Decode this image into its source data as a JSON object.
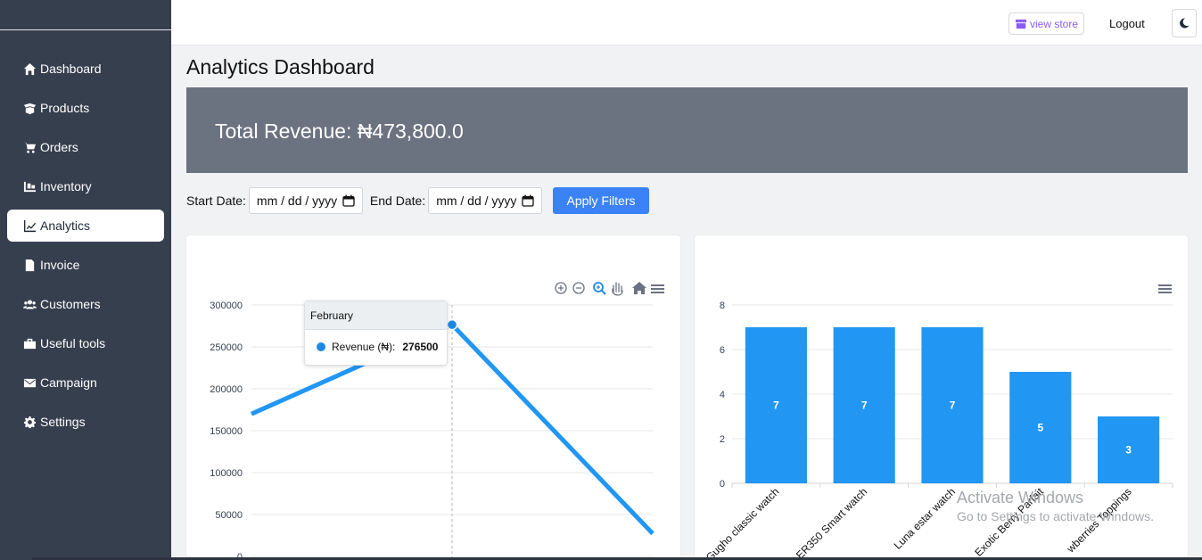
{
  "sidebar": {
    "items": [
      {
        "label": "Dashboard",
        "icon": "home-icon",
        "active": false
      },
      {
        "label": "Products",
        "icon": "box-open-icon",
        "active": false
      },
      {
        "label": "Orders",
        "icon": "cart-icon",
        "active": false
      },
      {
        "label": "Inventory",
        "icon": "dolly-icon",
        "active": false
      },
      {
        "label": "Analytics",
        "icon": "line-chart-icon",
        "active": true
      },
      {
        "label": "Invoice",
        "icon": "file-icon",
        "active": false
      },
      {
        "label": "Customers",
        "icon": "users-icon",
        "active": false
      },
      {
        "label": "Useful tools",
        "icon": "toolbox-icon",
        "active": false
      },
      {
        "label": "Campaign",
        "icon": "envelope-icon",
        "active": false
      },
      {
        "label": "Settings",
        "icon": "gear-icon",
        "active": false
      }
    ]
  },
  "topbar": {
    "view_store": "view store",
    "logout": "Logout",
    "theme_icon": "moon-icon"
  },
  "page": {
    "title": "Analytics Dashboard",
    "total_revenue": "Total Revenue: ₦473,800.0"
  },
  "filters": {
    "start_label": "Start Date:",
    "start_placeholder": "mm / dd / yyyy",
    "end_label": "End Date:",
    "end_placeholder": "mm / dd / yyyy",
    "apply_label": "Apply Filters"
  },
  "colors": {
    "sidebar_bg": "#363f4e",
    "accent": "#3b82f6",
    "series": "#2196f3",
    "banner": "#6b7280",
    "store_link": "#8b5cf6"
  },
  "chart_data": [
    {
      "type": "line",
      "title": "",
      "series": [
        {
          "name": "Revenue (₦)",
          "values": [
            170000,
            276500,
            27300
          ]
        }
      ],
      "ylim": [
        0,
        300000
      ],
      "y_ticks": [
        "0",
        "50000",
        "100000",
        "150000",
        "200000",
        "250000",
        "300000"
      ],
      "grid": true,
      "toolbar_icons": [
        "zoom-in-icon",
        "zoom-out-icon",
        "zoom-select-icon",
        "pan-icon",
        "reset-home-icon",
        "menu-icon"
      ],
      "tooltip": {
        "title": "February",
        "series_label": "Revenue (₦):",
        "value": "276500"
      }
    },
    {
      "type": "bar",
      "title": "",
      "categories": [
        "Gugho classic watch",
        "ER350 Smart watch",
        "Luna estar watch",
        "Exotic Berry Parfait",
        "Strawberries Toppings"
      ],
      "category_labels_visible": [
        "Gugho classic watch",
        "ER350 Smart watch",
        "Luna estar watch",
        "Exotic Berry Parfait",
        "wberries Toppings"
      ],
      "values": [
        7,
        7,
        7,
        5,
        3
      ],
      "ylim": [
        0,
        8
      ],
      "y_ticks": [
        "0",
        "2",
        "4",
        "6",
        "8"
      ],
      "grid": true,
      "toolbar_icons": [
        "menu-icon"
      ]
    }
  ],
  "watermark": {
    "line1": "Activate Windows",
    "line2": "Go to Settings to activate Windows."
  }
}
